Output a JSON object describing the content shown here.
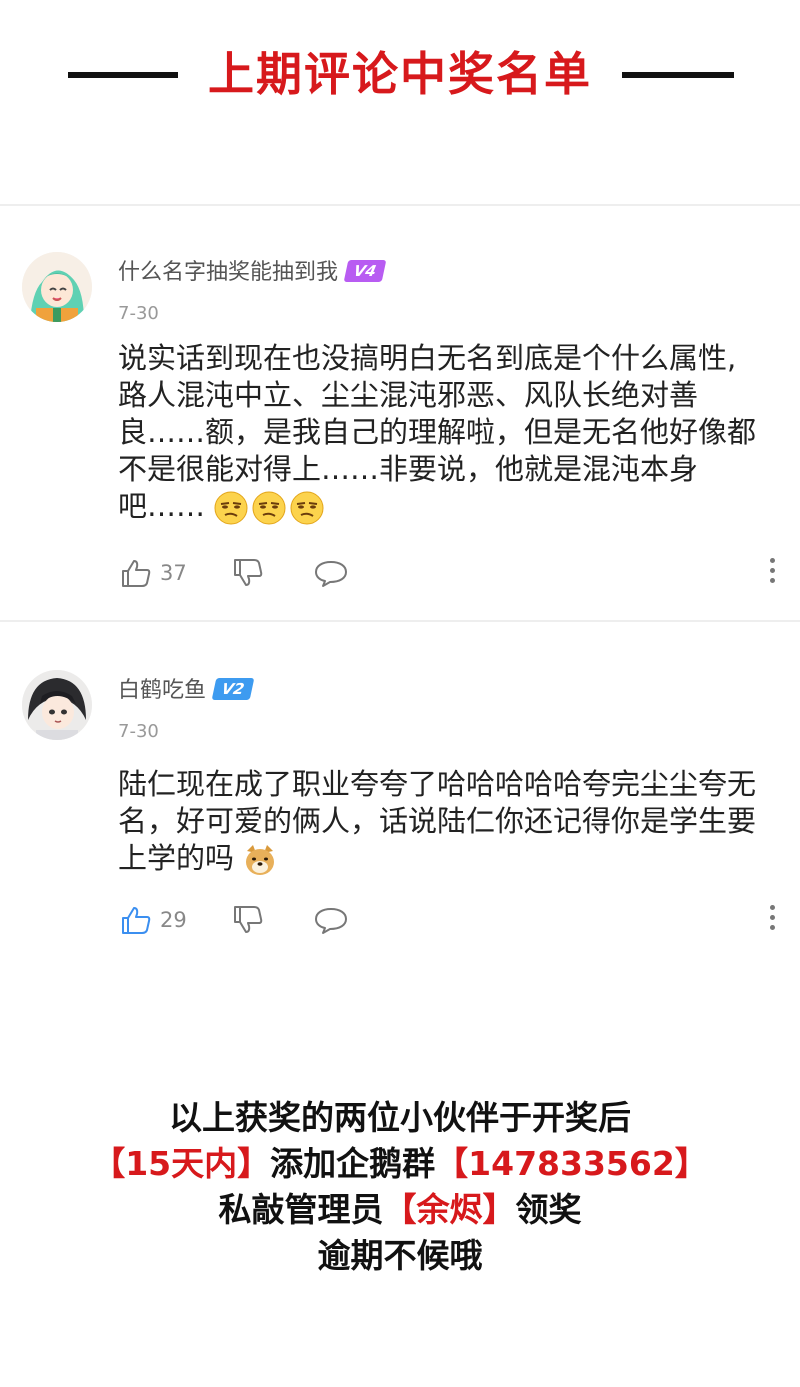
{
  "header": {
    "title": "上期评论中奖名单"
  },
  "comments": [
    {
      "username": "什么名字抽奖能抽到我",
      "badge": "V4",
      "badge_color": "#b85cf2",
      "date": "7-30",
      "lines": [
        "说实话到现在也没搞明白无名到底是个什么属性,",
        "路人混沌中立、尘尘混沌邪恶、风队长绝对善",
        "良……额，是我自己的理解啦，但是无名他好像都",
        "不是很能对得上……非要说，他就是混沌本身",
        "吧……"
      ],
      "emoji": "smirk-face-emoji",
      "emoji_count": 3,
      "likes": "37",
      "liked": false,
      "avatar": "anime-girl-green-hair-avatar"
    },
    {
      "username": "白鹤吃鱼",
      "badge": "V2",
      "badge_color": "#3d9bf0",
      "date": "7-30",
      "lines": [
        "陆仁现在成了职业夸夸了哈哈哈哈哈夸完尘尘夸无",
        "名，好可爱的俩人，话说陆仁你还记得你是学生要",
        "上学的吗"
      ],
      "emoji": "doge-emoji",
      "emoji_count": 1,
      "likes": "29",
      "liked": true,
      "avatar": "anime-boy-dark-hair-avatar"
    }
  ],
  "notice": {
    "line1": "以上获奖的两位小伙伴于开奖后",
    "line2_a": "【15天内】",
    "line2_b": "添加企鹅群",
    "line2_c": "【147833562】",
    "line3_a": "私敲管理员",
    "line3_b": "【余烬】",
    "line3_c": "领奖",
    "line4": "逾期不候哦"
  },
  "colors": {
    "accent_red": "#d7191c",
    "like_blue": "#3b8ff0"
  }
}
